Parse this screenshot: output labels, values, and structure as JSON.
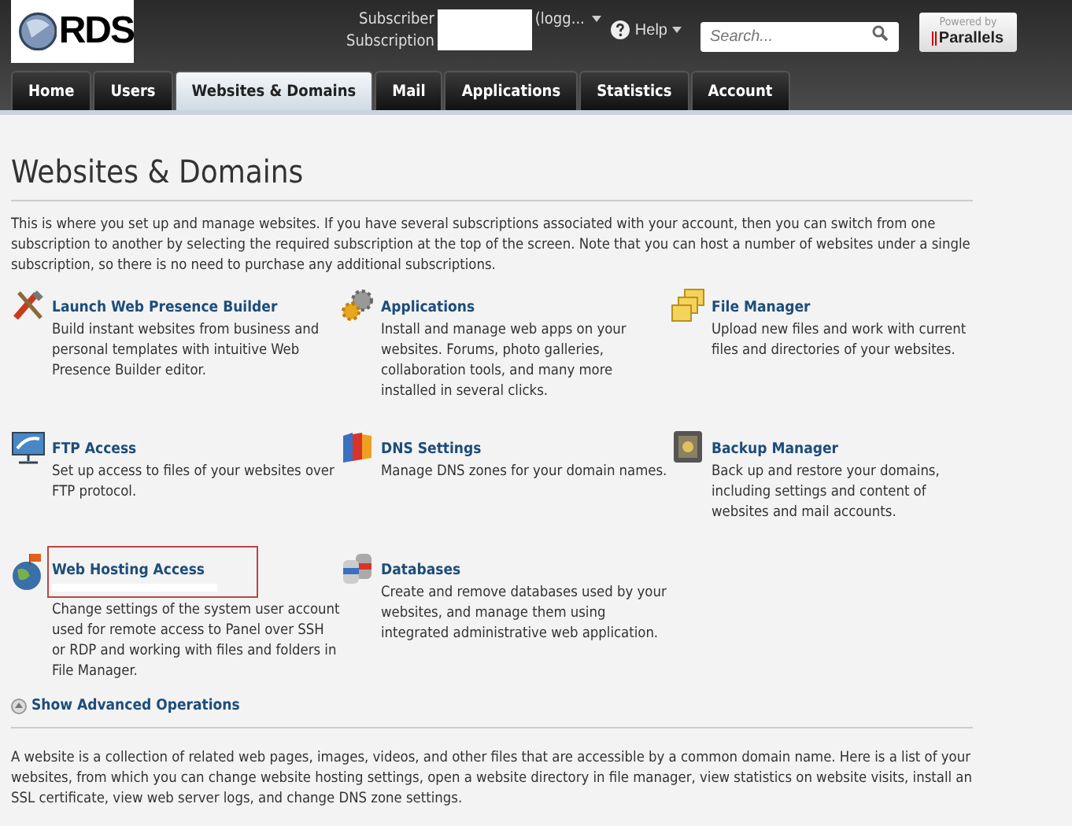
{
  "header": {
    "logo_text": "RDS",
    "subscriber_label": "Subscriber",
    "subscription_label": "Subscription",
    "login_text": "(logg...",
    "help": "Help",
    "search": {
      "placeholder": "Search..."
    },
    "powered_by": "Powered by",
    "brand": "Parallels"
  },
  "tabs": [
    {
      "label": "Home",
      "selected": false
    },
    {
      "label": "Users",
      "selected": false
    },
    {
      "label": "Websites & Domains",
      "selected": true
    },
    {
      "label": "Mail",
      "selected": false
    },
    {
      "label": "Applications",
      "selected": false
    },
    {
      "label": "Statistics",
      "selected": false
    },
    {
      "label": "Account",
      "selected": false
    }
  ],
  "page_title": "Websites & Domains",
  "intro": "This is where you set up and manage websites. If you have several subscriptions associated with your account, then you can switch from one subscription to another by selecting the required subscription at the top of the screen. Note that you can host a number of websites under a single subscription, so there is no need to purchase any additional subscriptions.",
  "tools": [
    {
      "kind": "builder",
      "title": "Launch Web Presence Builder",
      "description": "Build instant websites from business and personal templates with intuitive Web Presence Builder editor.",
      "highlighted": false
    },
    {
      "kind": "apps",
      "title": "Applications",
      "description": "Install and manage web apps on your websites. Forums, photo galleries, collaboration tools, and many more installed in several clicks.",
      "highlighted": false
    },
    {
      "kind": "files",
      "title": "File Manager",
      "description": "Upload new files and work with current files and directories of your websites.",
      "highlighted": false
    },
    {
      "kind": "ftp",
      "title": "FTP Access",
      "description": "Set up access to files of your websites over FTP protocol.",
      "highlighted": false
    },
    {
      "kind": "dns",
      "title": "DNS Settings",
      "description": "Manage DNS zones for your domain names.",
      "highlighted": false
    },
    {
      "kind": "backup",
      "title": "Backup Manager",
      "description": "Back up and restore your domains, including settings and content of websites and mail accounts.",
      "highlighted": false
    },
    {
      "kind": "hosting",
      "title": "Web Hosting Access",
      "description": "Change settings of the system user account used for remote access to Panel over SSH or RDP and working with files and folders in File Manager.",
      "highlighted": true
    },
    {
      "kind": "db",
      "title": "Databases",
      "description": "Create and remove databases used by your websites, and manage them using integrated administrative web application.",
      "highlighted": false
    }
  ],
  "advanced_link": "Show Advanced Operations",
  "footer_text": "A website is a collection of related web pages, images, videos, and other files that are accessible by a common domain name. Here is a list of your websites, from which you can change website hosting settings, open a website directory in file manager, view statistics on website visits, install an SSL certificate, view web server logs, and change DNS zone settings."
}
